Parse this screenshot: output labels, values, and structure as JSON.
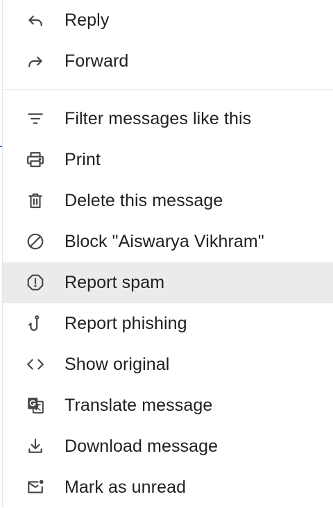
{
  "menu": {
    "items": [
      {
        "label": "Reply",
        "icon": "reply-icon"
      },
      {
        "label": "Forward",
        "icon": "forward-icon"
      },
      {
        "label": "Filter messages like this",
        "icon": "filter-icon"
      },
      {
        "label": "Print",
        "icon": "print-icon"
      },
      {
        "label": "Delete this message",
        "icon": "trash-icon"
      },
      {
        "label": "Block \"Aiswarya Vikhram\"",
        "icon": "block-icon"
      },
      {
        "label": "Report spam",
        "icon": "report-spam-icon",
        "hovered": true
      },
      {
        "label": "Report phishing",
        "icon": "phishing-hook-icon"
      },
      {
        "label": "Show original",
        "icon": "code-brackets-icon"
      },
      {
        "label": "Translate message",
        "icon": "translate-icon"
      },
      {
        "label": "Download message",
        "icon": "download-icon"
      },
      {
        "label": "Mark as unread",
        "icon": "mark-unread-icon"
      }
    ]
  },
  "colors": {
    "text": "#1f1f1f",
    "icon": "#444746",
    "hover_background": "#ebebeb",
    "divider": "#dadce0"
  }
}
